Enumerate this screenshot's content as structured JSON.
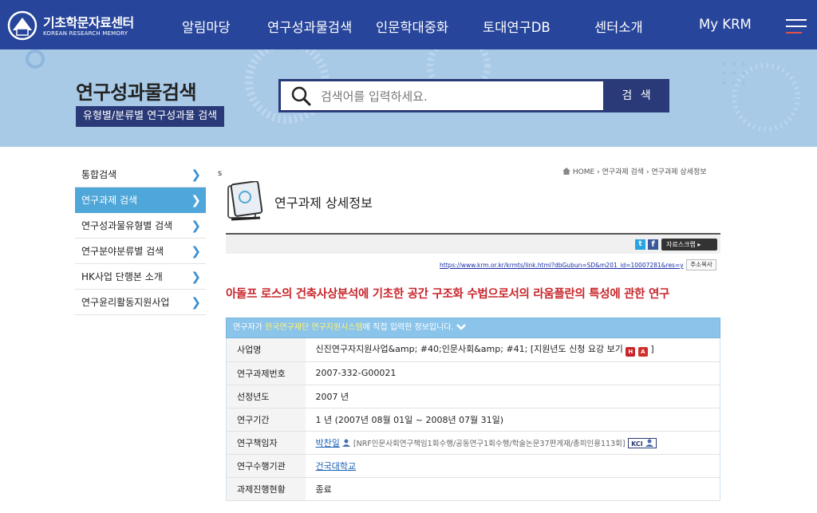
{
  "header": {
    "logo_title": "기초학문자료센터",
    "logo_sub": "KOREAN RESEARCH MEMORY",
    "nav": [
      "알림마당",
      "연구성과물검색",
      "인문학대중화",
      "토대연구DB",
      "센터소개",
      "My KRM"
    ]
  },
  "banner": {
    "title": "연구성과물검색",
    "subtitle": "유형별/분류별 연구성과물 검색",
    "search_placeholder": "검색어를 입력하세요.",
    "search_button": "검 색"
  },
  "sidebar": {
    "items": [
      {
        "label": "통합검색"
      },
      {
        "label": "연구과제 검색"
      },
      {
        "label": "연구성과물유형별 검색"
      },
      {
        "label": "연구분야분류별 검색"
      },
      {
        "label": "HK사업 단행본 소개"
      },
      {
        "label": "연구윤리활동지원사업"
      }
    ],
    "active_index": 1,
    "arrow": "❯"
  },
  "main": {
    "stray_char": "s",
    "breadcrumb": [
      "HOME",
      "연구과제 검색",
      "연구과제 상세정보"
    ],
    "page_title": "연구과제 상세정보",
    "share": {
      "twitter": "t",
      "facebook": "f",
      "scrap_label": "자료스크랩 ▸"
    },
    "url": "https://www.krm.or.kr/krmts/link.html?dbGubun=SD&m201_id=10007281&res=y",
    "copy_button": "주소복사",
    "project_title": "아돌프 로스의 건축사상분석에 기초한 공간 구조화 수법으로서의 라움플란의 특성에 관한 연구",
    "notice": {
      "prefix": "연구자가 ",
      "highlight": "한국연구재단 연구지원시스템",
      "suffix": "에 직접 입력한 정보입니다."
    },
    "rows": {
      "program": {
        "label": "사업명",
        "value": "신진연구자지원사업&amp; #40;인문사회&amp; #41; [지원년도 신청 요강 보기",
        "close": "]"
      },
      "project_no": {
        "label": "연구과제번호",
        "value": "2007-332-G00021"
      },
      "year": {
        "label": "선정년도",
        "value": "2007 년"
      },
      "period": {
        "label": "연구기간",
        "value": "1 년 (2007년 08월 01일 ~ 2008년 07월 31일)"
      },
      "pi": {
        "label": "연구책임자",
        "name": "박찬일",
        "detail": "[NRF인문사회연구책임1회수행/공동연구1회수행/학술논문37편게재/총피인용113회]",
        "kci": "KCI"
      },
      "institution": {
        "label": "연구수행기관",
        "value": "건국대학교"
      },
      "status": {
        "label": "과제진행현황",
        "value": "종료"
      }
    }
  }
}
